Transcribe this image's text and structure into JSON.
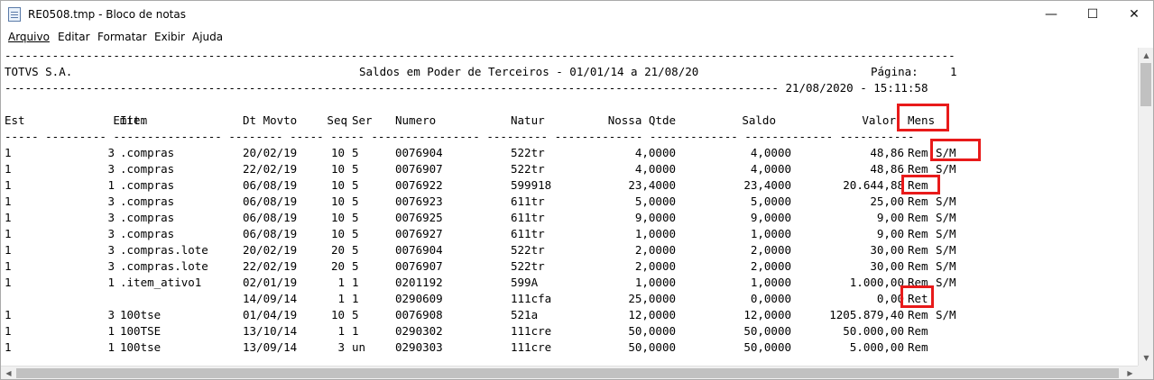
{
  "window": {
    "title": "RE0508.tmp - Bloco de notas",
    "minimize": "—",
    "maximize": "☐",
    "close": "✕"
  },
  "menu": [
    "Arquivo",
    "Editar",
    "Formatar",
    "Exibir",
    "Ajuda"
  ],
  "report": {
    "rule_top": "--------------------------------------------------------------------------------------------------------------------------------------------",
    "company": "TOTVS S.A.",
    "title": "Saldos em Poder de Terceiros - 01/01/14 a 21/08/20",
    "page_label": "Página:",
    "page_number": "1",
    "rule_date": "------------------------------------------------------------------------------------------------------------------ 21/08/2020 - 15:11:58",
    "columns": [
      "Est",
      "Emit.",
      "Item",
      "Dt Movto",
      "Seq",
      "Ser",
      "Numero",
      "Natur",
      "Nossa Qtde",
      "Saldo",
      "Valor",
      "Mens"
    ],
    "dashes": "----- --------- ---------------- -------- ----- ----- ---------------- --------- ------------- ------------- ------------- -----------",
    "rows": [
      {
        "est": "1",
        "emit": "3",
        "item": ".compras",
        "dt": "20/02/19",
        "seq": "10",
        "ser": "5",
        "numero": "0076904",
        "natur": "522tr",
        "qtde": "4,0000",
        "saldo": "4,0000",
        "valor": "48,86",
        "mens1": "Rem",
        "mens2": "S/M"
      },
      {
        "est": "1",
        "emit": "3",
        "item": ".compras",
        "dt": "22/02/19",
        "seq": "10",
        "ser": "5",
        "numero": "0076907",
        "natur": "522tr",
        "qtde": "4,0000",
        "saldo": "4,0000",
        "valor": "48,86",
        "mens1": "Rem",
        "mens2": "S/M"
      },
      {
        "est": "1",
        "emit": "1",
        "item": ".compras",
        "dt": "06/08/19",
        "seq": "10",
        "ser": "5",
        "numero": "0076922",
        "natur": "599918",
        "qtde": "23,4000",
        "saldo": "23,4000",
        "valor": "20.644,88",
        "mens1": "Rem",
        "mens2": ""
      },
      {
        "est": "1",
        "emit": "3",
        "item": ".compras",
        "dt": "06/08/19",
        "seq": "10",
        "ser": "5",
        "numero": "0076923",
        "natur": "611tr",
        "qtde": "5,0000",
        "saldo": "5,0000",
        "valor": "25,00",
        "mens1": "Rem",
        "mens2": "S/M"
      },
      {
        "est": "1",
        "emit": "3",
        "item": ".compras",
        "dt": "06/08/19",
        "seq": "10",
        "ser": "5",
        "numero": "0076925",
        "natur": "611tr",
        "qtde": "9,0000",
        "saldo": "9,0000",
        "valor": "9,00",
        "mens1": "Rem",
        "mens2": "S/M"
      },
      {
        "est": "1",
        "emit": "3",
        "item": ".compras",
        "dt": "06/08/19",
        "seq": "10",
        "ser": "5",
        "numero": "0076927",
        "natur": "611tr",
        "qtde": "1,0000",
        "saldo": "1,0000",
        "valor": "9,00",
        "mens1": "Rem",
        "mens2": "S/M"
      },
      {
        "est": "1",
        "emit": "3",
        "item": ".compras.lote",
        "dt": "20/02/19",
        "seq": "20",
        "ser": "5",
        "numero": "0076904",
        "natur": "522tr",
        "qtde": "2,0000",
        "saldo": "2,0000",
        "valor": "30,00",
        "mens1": "Rem",
        "mens2": "S/M"
      },
      {
        "est": "1",
        "emit": "3",
        "item": ".compras.lote",
        "dt": "22/02/19",
        "seq": "20",
        "ser": "5",
        "numero": "0076907",
        "natur": "522tr",
        "qtde": "2,0000",
        "saldo": "2,0000",
        "valor": "30,00",
        "mens1": "Rem",
        "mens2": "S/M"
      },
      {
        "est": "1",
        "emit": "1",
        "item": ".item_ativo1",
        "dt": "02/01/19",
        "seq": "1",
        "ser": "1",
        "numero": "0201192",
        "natur": "599A",
        "qtde": "1,0000",
        "saldo": "1,0000",
        "valor": "1.000,00",
        "mens1": "Rem",
        "mens2": "S/M"
      },
      {
        "est": "",
        "emit": "",
        "item": "",
        "dt": "14/09/14",
        "seq": "1",
        "ser": "1",
        "numero": "0290609",
        "natur": "111cfa",
        "qtde": "25,0000",
        "saldo": "0,0000",
        "valor": "0,00",
        "mens1": "Ret",
        "mens2": ""
      },
      {
        "est": "1",
        "emit": "3",
        "item": "100tse",
        "dt": "01/04/19",
        "seq": "10",
        "ser": "5",
        "numero": "0076908",
        "natur": "521a",
        "qtde": "12,0000",
        "saldo": "12,0000",
        "valor": "1205.879,40",
        "mens1": "Rem",
        "mens2": "S/M"
      },
      {
        "est": "1",
        "emit": "1",
        "item": "100TSE",
        "dt": "13/10/14",
        "seq": "1",
        "ser": "1",
        "numero": "0290302",
        "natur": "111cre",
        "qtde": "50,0000",
        "saldo": "50,0000",
        "valor": "50.000,00",
        "mens1": "Rem",
        "mens2": ""
      },
      {
        "est": "1",
        "emit": "1",
        "item": "100tse",
        "dt": "13/09/14",
        "seq": "3",
        "ser": "un",
        "numero": "0290303",
        "natur": "111cre",
        "qtde": "50,0000",
        "saldo": "50,0000",
        "valor": "5.000,00",
        "mens1": "Rem",
        "mens2": ""
      }
    ]
  },
  "highlight_color": "#e81a1a"
}
